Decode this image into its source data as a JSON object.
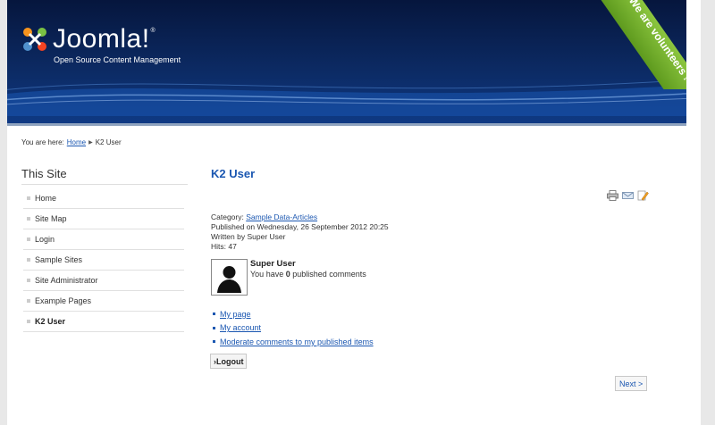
{
  "header": {
    "logo_text": "Joomla!",
    "logo_registered": "®",
    "tagline": "Open Source Content Management",
    "ribbon_text": "We are volunteers !"
  },
  "breadcrumb": {
    "prefix": "You are here:",
    "home": "Home",
    "current": "K2 User"
  },
  "sidebar": {
    "title": "This Site",
    "items": [
      {
        "label": "Home"
      },
      {
        "label": "Site Map"
      },
      {
        "label": "Login"
      },
      {
        "label": "Sample Sites"
      },
      {
        "label": "Site Administrator"
      },
      {
        "label": "Example Pages"
      },
      {
        "label": "K2 User"
      }
    ]
  },
  "article": {
    "title": "K2 User",
    "category_label": "Category:",
    "category": "Sample Data-Articles",
    "published": "Published on Wednesday, 26 September 2012 20:25",
    "written_by": "Written by Super User",
    "hits": "Hits: 47"
  },
  "user": {
    "name": "Super User",
    "comments_prefix": "You have",
    "comments_count": "0",
    "comments_suffix": "published comments"
  },
  "links": [
    {
      "label": "My page"
    },
    {
      "label": "My account"
    },
    {
      "label": "Moderate comments to my published items"
    }
  ],
  "buttons": {
    "logout": "›Logout",
    "next": "Next >"
  },
  "icons": {
    "print": "print-icon",
    "email": "email-icon",
    "edit": "edit-icon"
  }
}
